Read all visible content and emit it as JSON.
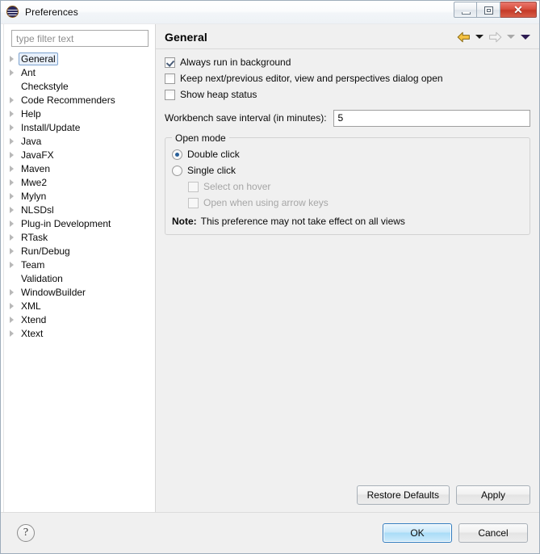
{
  "window": {
    "title": "Preferences",
    "icon": "eclipse-icon",
    "controls": {
      "minimize": "minimize-icon",
      "restore": "restore-icon",
      "close": "✕"
    }
  },
  "sidebar": {
    "filter": {
      "placeholder": "type filter text",
      "value": ""
    },
    "items": [
      {
        "label": "General",
        "expandable": true,
        "selected": true
      },
      {
        "label": "Ant",
        "expandable": true,
        "selected": false
      },
      {
        "label": "Checkstyle",
        "expandable": false,
        "selected": false
      },
      {
        "label": "Code Recommenders",
        "expandable": true,
        "selected": false
      },
      {
        "label": "Help",
        "expandable": true,
        "selected": false
      },
      {
        "label": "Install/Update",
        "expandable": true,
        "selected": false
      },
      {
        "label": "Java",
        "expandable": true,
        "selected": false
      },
      {
        "label": "JavaFX",
        "expandable": true,
        "selected": false
      },
      {
        "label": "Maven",
        "expandable": true,
        "selected": false
      },
      {
        "label": "Mwe2",
        "expandable": true,
        "selected": false
      },
      {
        "label": "Mylyn",
        "expandable": true,
        "selected": false
      },
      {
        "label": "NLSDsl",
        "expandable": true,
        "selected": false
      },
      {
        "label": "Plug-in Development",
        "expandable": true,
        "selected": false
      },
      {
        "label": "RTask",
        "expandable": true,
        "selected": false
      },
      {
        "label": "Run/Debug",
        "expandable": true,
        "selected": false
      },
      {
        "label": "Team",
        "expandable": true,
        "selected": false
      },
      {
        "label": "Validation",
        "expandable": false,
        "selected": false
      },
      {
        "label": "WindowBuilder",
        "expandable": true,
        "selected": false
      },
      {
        "label": "XML",
        "expandable": true,
        "selected": false
      },
      {
        "label": "Xtend",
        "expandable": true,
        "selected": false
      },
      {
        "label": "Xtext",
        "expandable": true,
        "selected": false
      }
    ]
  },
  "page": {
    "title": "General",
    "nav": {
      "back_icon": "back-arrow-icon",
      "back_menu_icon": "chevron-down-icon",
      "forward_icon": "forward-arrow-icon",
      "forward_menu_icon": "chevron-down-icon",
      "view_menu_icon": "chevron-down-icon"
    },
    "checkboxes": [
      {
        "label": "Always run in background",
        "checked": true,
        "enabled": true
      },
      {
        "label": "Keep next/previous editor, view and perspectives dialog open",
        "checked": false,
        "enabled": true
      },
      {
        "label": "Show heap status",
        "checked": false,
        "enabled": true
      }
    ],
    "save_interval": {
      "label": "Workbench save interval (in minutes):",
      "value": "5"
    },
    "open_mode": {
      "title": "Open mode",
      "radios": [
        {
          "label": "Double click",
          "selected": true
        },
        {
          "label": "Single click",
          "selected": false
        }
      ],
      "sub_checkboxes": [
        {
          "label": "Select on hover",
          "checked": false,
          "enabled": false
        },
        {
          "label": "Open when using arrow keys",
          "checked": false,
          "enabled": false
        }
      ],
      "note_prefix": "Note:",
      "note_text": "This preference may not take effect on all views"
    },
    "actions": {
      "restore_defaults": "Restore Defaults",
      "apply": "Apply"
    }
  },
  "footer": {
    "help_icon": "?",
    "ok": "OK",
    "cancel": "Cancel"
  },
  "colors": {
    "accent": "#2a6099",
    "close_red": "#c43a28",
    "selection_bg": "#e8f0fb",
    "selection_border": "#7da2ce",
    "panel_bg": "#f0f0f0",
    "tree_bg": "#ffffff",
    "nav_back_gold": "#f5c242"
  }
}
